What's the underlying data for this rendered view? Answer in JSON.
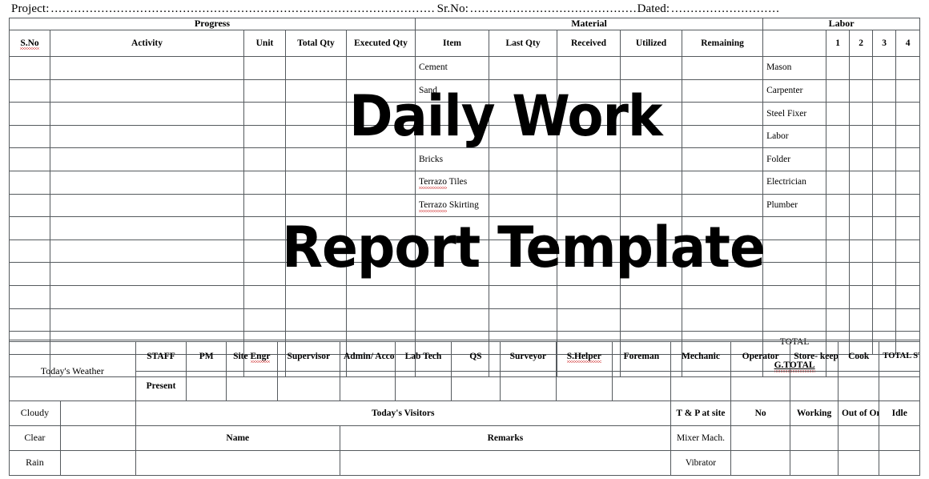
{
  "header": {
    "project_label": "Project:",
    "project_dots": "...................................................................................................",
    "srno_label": "Sr.No:",
    "srno_dots": "...........................................",
    "dated_label": "Dated:",
    "dated_dots": "............................"
  },
  "watermark": {
    "line1": "Daily Work",
    "line2": "Report Template"
  },
  "main_table": {
    "groups": {
      "progress": "Progress",
      "material": "Material",
      "labor": "Labor"
    },
    "columns": {
      "sno": "S.No",
      "activity": "Activity",
      "unit": "Unit",
      "total_qty": "Total Qty",
      "executed_qty": "Executed Qty",
      "item": "Item",
      "last_qty": "Last Qty",
      "received": "Received",
      "utilized": "Utilized",
      "remaining": "Remaining",
      "labor_role": "",
      "l1": "1",
      "l2": "2",
      "l3": "3",
      "l4": "4"
    },
    "material_items": [
      "Cement",
      "Sand",
      "",
      "",
      "Bricks",
      "Terrazo Tiles",
      "Terrazo Skirting",
      "",
      "",
      "",
      "",
      ""
    ],
    "labor_roles": [
      "Mason",
      "Carpenter",
      "Steel Fixer",
      "Labor",
      "Folder",
      "Electrician",
      "Plumber",
      "",
      "",
      "",
      "",
      ""
    ],
    "total_label": "TOTAL",
    "grand_total_label": "G.TOTAL",
    "body_row_count": 12
  },
  "staff_table": {
    "weather_label": "Today's Weather",
    "staff_label": "STAFF",
    "present_label": "Present",
    "staff_columns": [
      "PM",
      "Site Engr",
      "Supervisor",
      "Admin/ Account",
      "Lab Tech",
      "QS",
      "Surveyor",
      "S.Helper",
      "Foreman",
      "Mechanic",
      "Operator",
      "Store- keeper",
      "Cook",
      "TOTAL STAFF"
    ],
    "weather_options": [
      "Cloudy",
      "Clear",
      "Rain"
    ],
    "visitors_label": "Today's Visitors",
    "name_label": "Name",
    "remarks_label": "Remarks",
    "tp_label": "T & P at site",
    "tp_columns": [
      "No",
      "Working",
      "Out of Order",
      "Idle"
    ],
    "tp_items": [
      "Mixer Mach.",
      "Vibrator"
    ]
  }
}
